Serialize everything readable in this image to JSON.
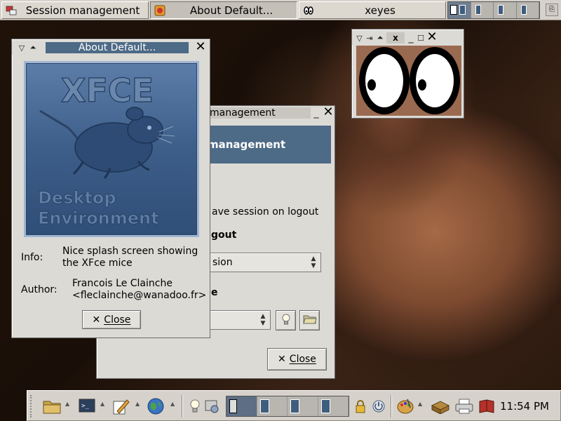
{
  "taskbar": {
    "tasks": [
      {
        "label": "Session management",
        "icon": "session-icon"
      },
      {
        "label": "About Default...",
        "icon": "splash-icon"
      },
      {
        "label": "xeyes",
        "icon": "eyes-icon"
      }
    ]
  },
  "session_window": {
    "title": "management",
    "banner": "management",
    "save_session_text": "ave session on logout",
    "logout_heading": "gout",
    "combo1_value": "sion",
    "section_heading": "e",
    "combo2_value": "",
    "close_label": "Close"
  },
  "about_window": {
    "title": "About Default...",
    "splash": {
      "logo_text": "XFCE",
      "line1": "Desktop",
      "line2": "Environment"
    },
    "info_label": "Info:",
    "info_value_line1": "Nice splash screen showing",
    "info_value_line2": "the XFce mice",
    "author_label": "Author:",
    "author_name": "Francois Le Clainche",
    "author_email": "<fleclainche@wanadoo.fr>",
    "close_label": "Close"
  },
  "xeyes_window": {
    "title_glyph": "x"
  },
  "panel": {
    "clock": "11:54 PM"
  },
  "colors": {
    "accent_title": "#4d6a86",
    "chrome": "#dcdad5"
  }
}
